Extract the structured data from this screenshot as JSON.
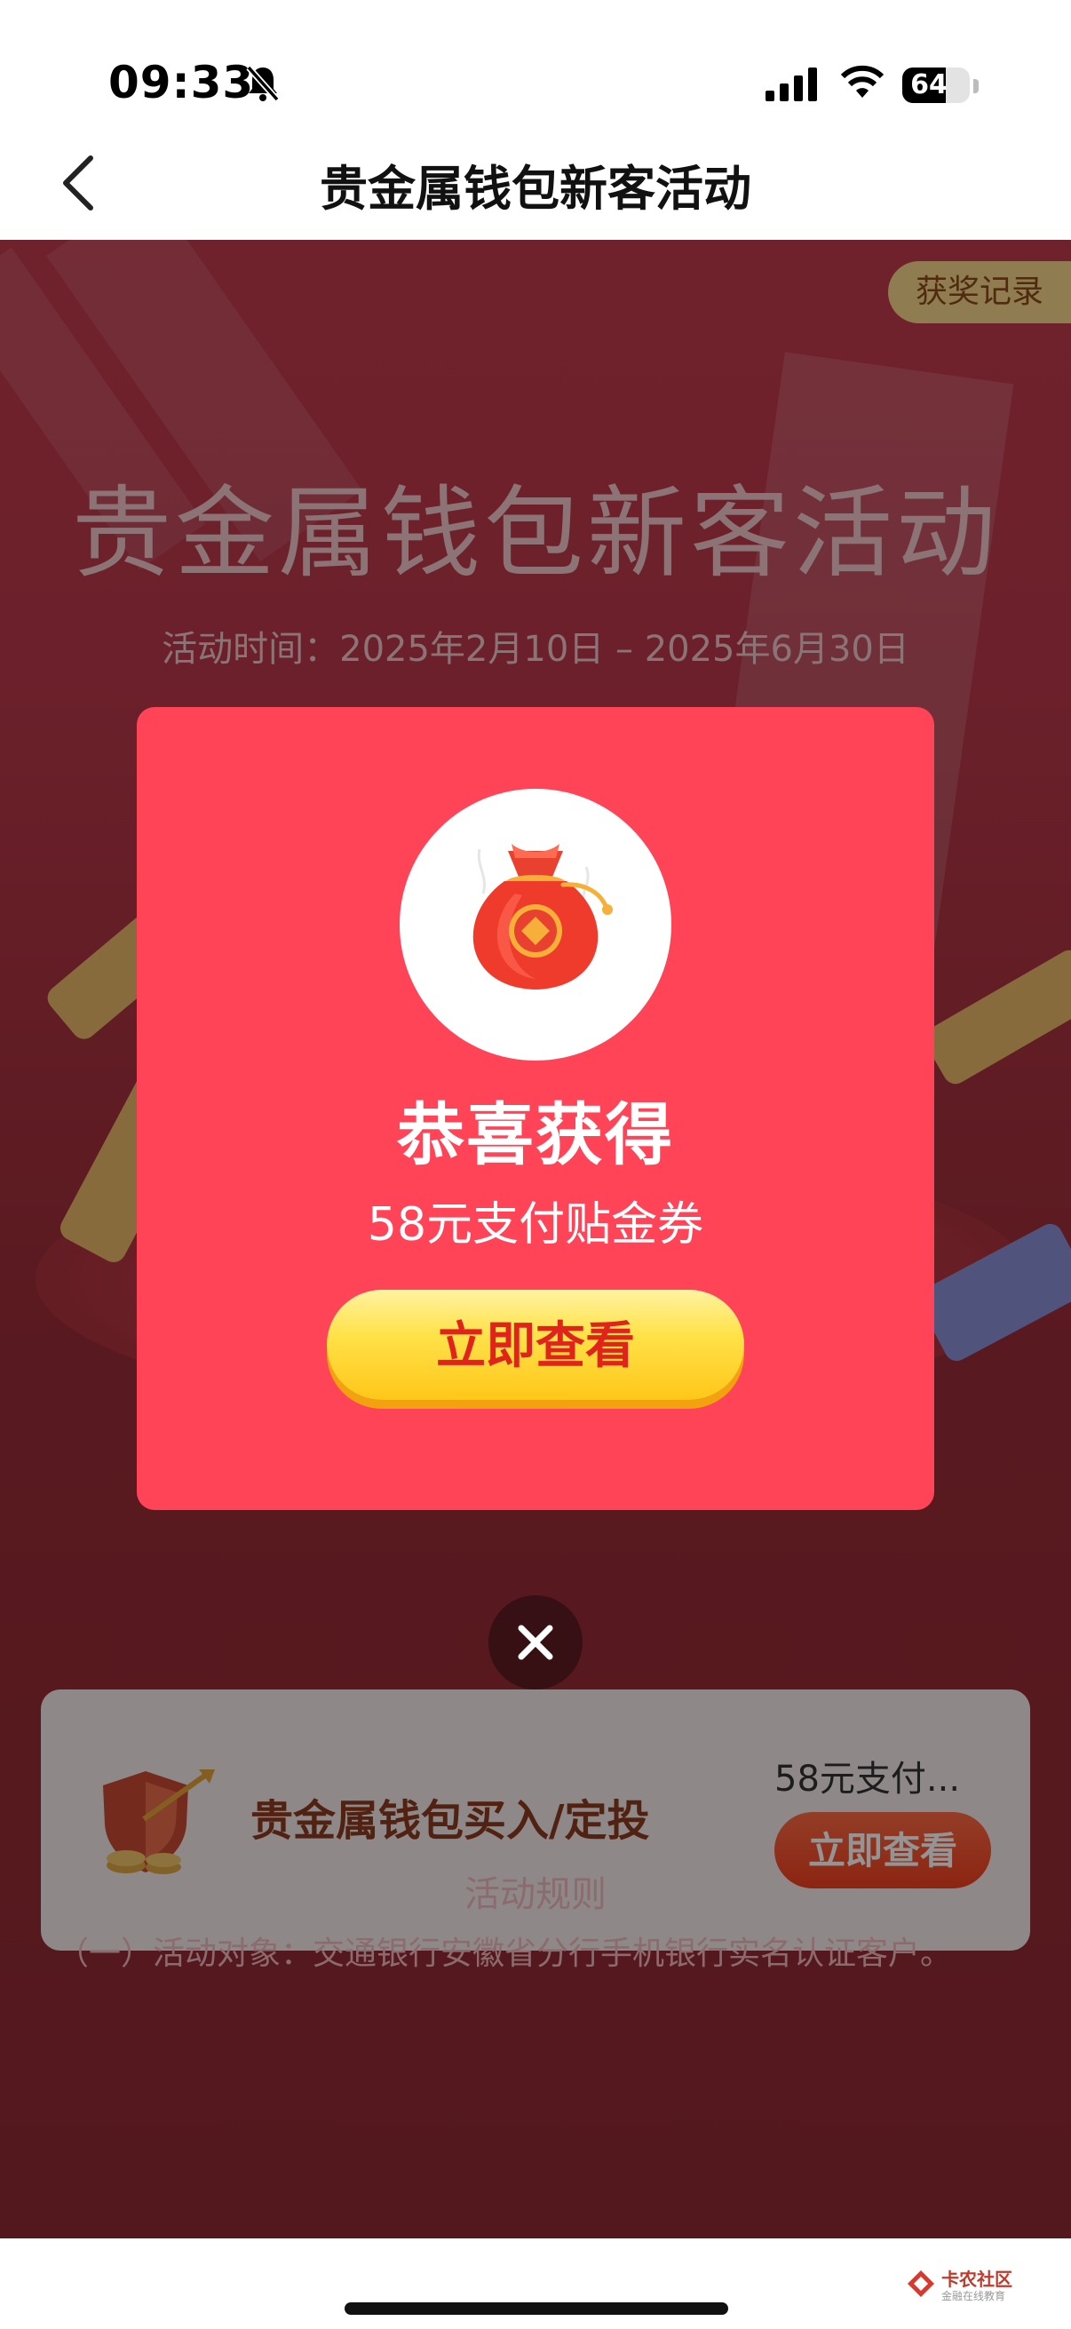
{
  "status_bar": {
    "time": "09:33",
    "battery": "64",
    "battery_level": 0.64,
    "icons": [
      "bell-slash-icon",
      "signal-icon",
      "wifi-icon",
      "battery-icon"
    ]
  },
  "nav": {
    "title": "贵金属钱包新客活动",
    "back_icon": "chevron-left-icon"
  },
  "page": {
    "record_chip": "获奖记录",
    "hero_title": "贵金属钱包新客活动",
    "hero_date": "活动时间：2025年2月10日 – 2025年6月30日",
    "task": {
      "title": "贵金属钱包买入/定投",
      "reward": "58元支付...",
      "button": "立即查看",
      "icon": "shield-coins-icon"
    },
    "rules_title": "活动规则",
    "rules_line": "（一）活动对象：交通银行安徽省分行手机银行实名认证客户。"
  },
  "modal": {
    "prize_icon": "red-money-bag-icon",
    "congrats": "恭喜获得",
    "prize_name": "58元支付贴金券",
    "view_button": "立即查看",
    "close_icon": "close-icon"
  },
  "watermark": {
    "name": "卡农社区",
    "sub": "金融在线教育"
  },
  "colors": {
    "modal_bg": "#ff4458",
    "button_yellow": "#ffd12a",
    "button_text": "#e0241c",
    "page_red": "#b9384a"
  }
}
